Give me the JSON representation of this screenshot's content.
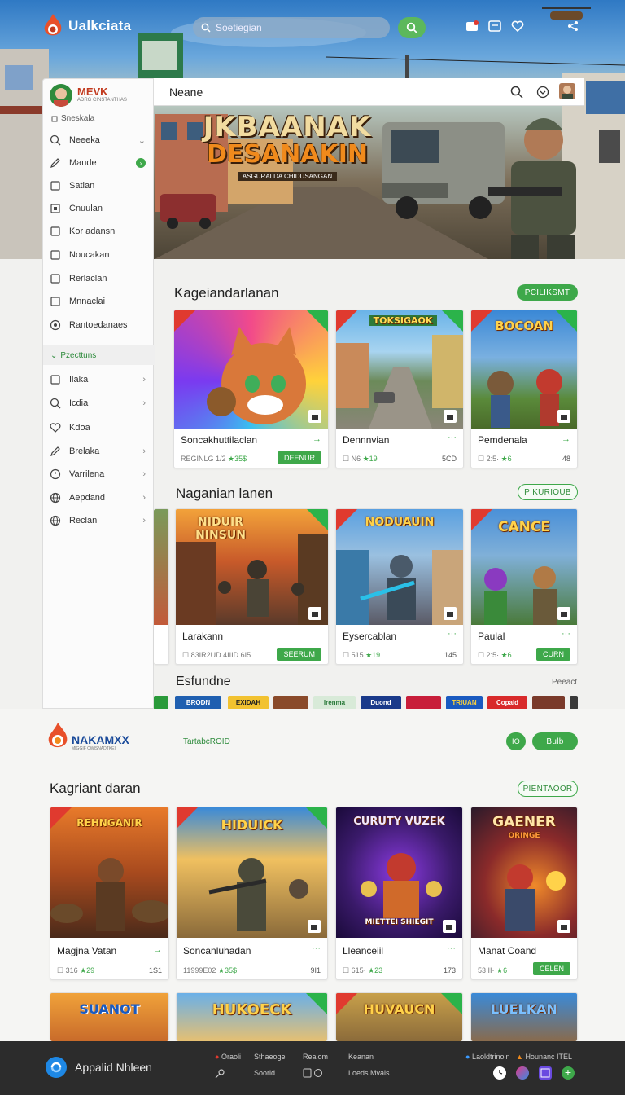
{
  "header": {
    "app_name": "Ualkciata",
    "search_placeholder": "Soetiegian"
  },
  "hero": {
    "title_line1": "JKBAANAK",
    "title_line2": "DESANAKIN",
    "tagline": "ASGURALDA CHIDUSANGAN"
  },
  "inner_header": {
    "title": "Neane"
  },
  "sidebar": {
    "user_name": "MEVK",
    "user_sub": "ADRG CINSTANTHAS",
    "section_label": "Sneskala",
    "items": [
      {
        "label": "Neeeka",
        "icon": "search-icon"
      },
      {
        "label": "Maude",
        "icon": "pencil-icon"
      },
      {
        "label": "Satlan",
        "icon": "square-icon"
      },
      {
        "label": "Cnuulan",
        "icon": "square-icon"
      },
      {
        "label": "Kor adansn",
        "icon": "square-icon"
      },
      {
        "label": "Noucakan",
        "icon": "square-icon"
      },
      {
        "label": "Rerlaclan",
        "icon": "square-icon"
      },
      {
        "label": "Mnnaclai",
        "icon": "square-icon"
      },
      {
        "label": "Rantoedanaes",
        "icon": "gear-icon"
      }
    ],
    "section2_label": "Pzecttuns",
    "items2": [
      {
        "label": "Ilaka",
        "icon": "square-icon"
      },
      {
        "label": "Icdia",
        "icon": "search-icon"
      },
      {
        "label": "Kdoa",
        "icon": "heart-icon"
      },
      {
        "label": "Brelaka",
        "icon": "pencil-icon"
      },
      {
        "label": "Varrilena",
        "icon": "clock-icon"
      },
      {
        "label": "Aepdand",
        "icon": "globe-icon"
      },
      {
        "label": "Reclan",
        "icon": "globe-icon"
      }
    ]
  },
  "section1": {
    "title": "Kageiandarlanan",
    "button": "PCILIKSMT",
    "cards": [
      {
        "name": "Soncakhuttilaclan",
        "meta": "REGINLG 1/2",
        "rating": "★35$",
        "action": "DEENUR"
      },
      {
        "name": "Dennnvian",
        "meta": "☐ N6",
        "rating": "★19",
        "count": "5CD",
        "art_title": "TOKSIGAOK"
      },
      {
        "name": "Pemdenala",
        "meta": "☐ 2:5·",
        "rating": "★6",
        "count": "48",
        "art_title": "BOCOAN"
      }
    ]
  },
  "section2": {
    "title": "Naganian lanen",
    "button": "PIKURIOUB",
    "cards": [
      {
        "name": "Larakann",
        "meta": "☐ 83IR2UD 4IIID",
        "rating": "6I5",
        "action": "SEERUM",
        "art_title": "NIDUIR NINSUN"
      },
      {
        "name": "Eysercablan",
        "meta": "☐ 515",
        "rating": "★19",
        "count": "145",
        "art_title": "NODUAUIN"
      },
      {
        "name": "Paulal",
        "meta": "☐ 2:5·",
        "rating": "★6",
        "action": "CURN",
        "art_title": "CANCE"
      }
    ]
  },
  "brands": {
    "title": "Esfundne",
    "link": "Peeact",
    "items": [
      "BRODN",
      "EXIDAH",
      "",
      "Irenma",
      "Duond",
      "",
      "TRIUAN",
      "Copaid",
      ""
    ]
  },
  "second_page": {
    "logo_name": "NAKAMXX",
    "logo_sub": "MIGGIF CWISNADTKEI",
    "center_text": "TartabcROID",
    "pill_num": "IO",
    "pill_label": "Bulb",
    "section_title": "Kagriant daran",
    "section_button": "PIENTAOOR",
    "cards": [
      {
        "name": "Magjna Vatan",
        "meta": "☐ 316",
        "rating": "★29",
        "count": "1S1",
        "art_title": "REHNGANIR"
      },
      {
        "name": "Soncanluhadan",
        "meta": "11999E02",
        "rating": "★35$",
        "count": "9I1",
        "art_title": "HIDUICK"
      },
      {
        "name": "Lleanceiil",
        "meta": "☐ 615·",
        "rating": "★23",
        "count": "173",
        "art_title": "CURUTY VUZEK",
        "art_sub": "MIETTEI SHIEGIT"
      },
      {
        "name": "Manat Coand",
        "meta": "53 II·",
        "rating": "★6",
        "action": "CELEN",
        "art_title": "GAENER",
        "art_sub": "ORINGE"
      }
    ],
    "row2_titles": [
      "SUANOT",
      "HUKOECK",
      "HUVAUCN",
      "LUELKAN"
    ]
  },
  "footer": {
    "app_name": "Appalid Nhleen",
    "links": [
      "Oraoli",
      "Sthaeoge",
      "Realom",
      "Keanan",
      "Soorid",
      "Loeds Mvais"
    ],
    "right_text1": "Laoldtrinoln",
    "right_text2": "Hounanc ITEL"
  },
  "colors": {
    "accent": "#3ea84a",
    "footer": "#2c2c2c"
  }
}
